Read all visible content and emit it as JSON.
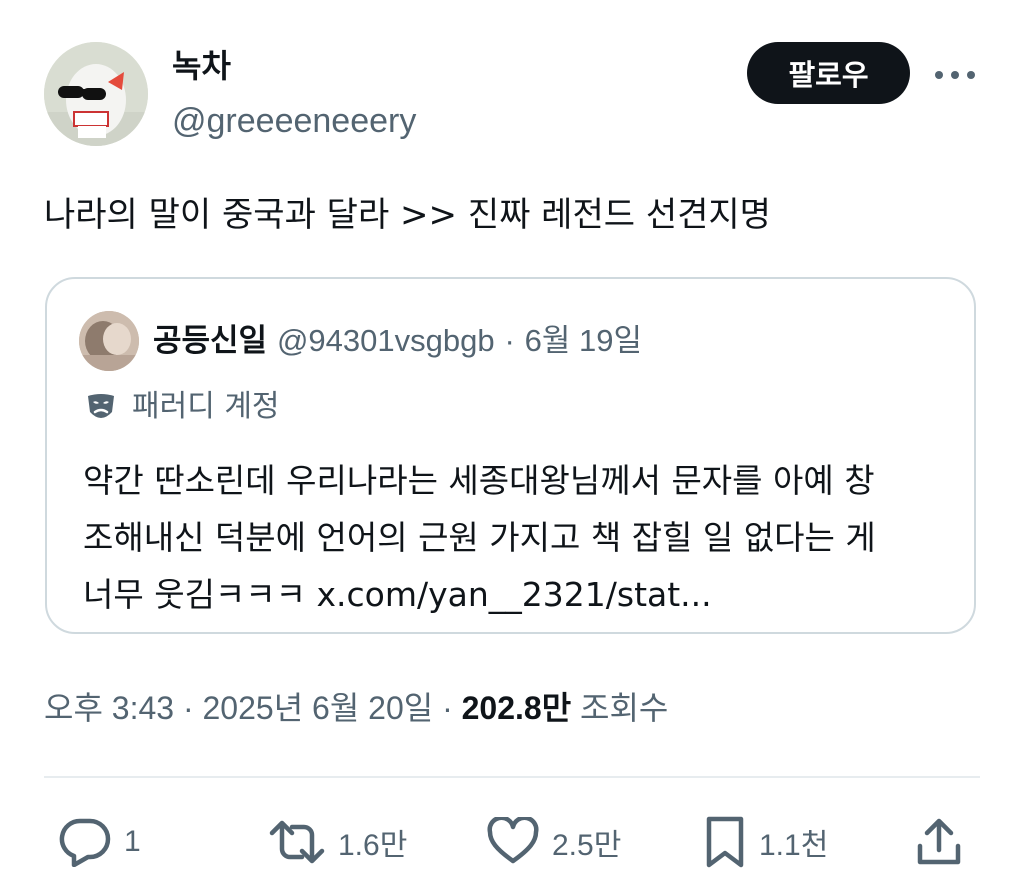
{
  "author": {
    "display_name": "녹차",
    "handle": "@greeeeneeery"
  },
  "follow_label": "팔로우",
  "tweet": {
    "text": "나라의 말이 중국과 달라 >> 진짜 레전드 선견지명"
  },
  "quote": {
    "display_name": "공등신일",
    "handle": "@94301vsgbgb",
    "separator": "·",
    "date": "6월 19일",
    "parody_label": "패러디 계정",
    "lines": [
      "약간 딴소린데 우리나라는 세종대왕님께서 문자를 아예 창",
      "조해내신 덕분에 언어의 근원 가지고 책 잡힐 일 없다는 게",
      "너무 웃김ㅋㅋㅋ x.com/yan__2321/stat..."
    ]
  },
  "meta": {
    "time": "오후 3:43",
    "separator": "·",
    "date": "2025년 6월 20일",
    "views_count": "202.8만",
    "views_label": "조회수"
  },
  "actions": {
    "reply_count": "1",
    "repost_count": "1.6만",
    "like_count": "2.5만",
    "bookmark_count": "1.1천"
  },
  "colors": {
    "text_primary": "#0f1419",
    "text_secondary": "#536471",
    "border": "#cfd9de",
    "button_bg": "#0f1419"
  }
}
